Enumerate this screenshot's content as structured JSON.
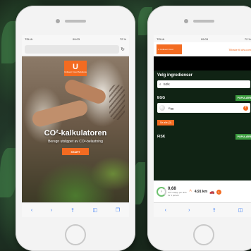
{
  "left_phone": {
    "status": {
      "carrier": "TELIA",
      "time": "09:03",
      "battery": "72 %"
    },
    "hero_title": "CO²-kalkulatoren",
    "hero_subtitle": "Beregn utslippet av CO²-belastning",
    "start_label": "START"
  },
  "right_phone": {
    "status": {
      "carrier": "TELIA",
      "time": "09:03",
      "battery": "72 %"
    },
    "header_link": "Tilbake til ufs.com",
    "title": "Velg ingredienser",
    "search_placeholder": "SØK",
    "category_1": "EGG",
    "category_2": "FISK",
    "badge": "POPULÆRE",
    "item_1": "Egg",
    "more_label": "Se alle (2)",
    "co2_value": "0,68",
    "co2_caption": "CO² utslipp per dish",
    "per_person": "for 1 person",
    "distance": "4,91 km",
    "count": "1"
  },
  "colors": {
    "brand_orange": "#f36b21",
    "popular_green": "#3a9a3d"
  }
}
